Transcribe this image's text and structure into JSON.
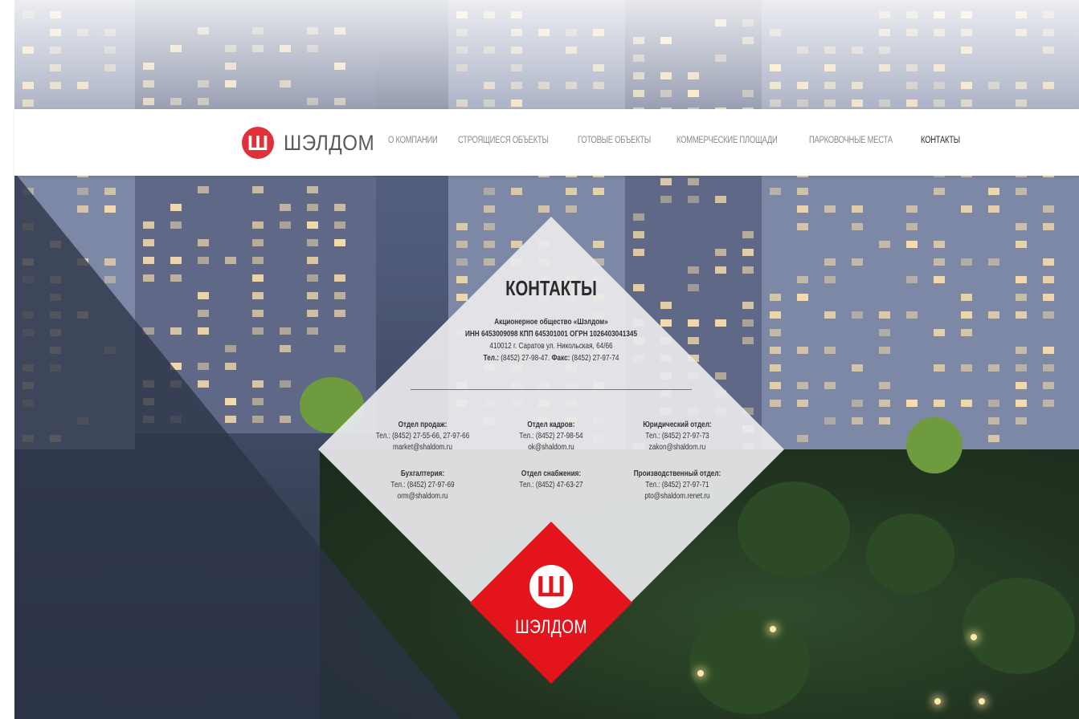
{
  "brand": {
    "name": "ШЭЛДОМ",
    "logo_glyph": "Ш",
    "accent_color": "#e3141c"
  },
  "nav": {
    "items": [
      {
        "label": "О КОМПАНИИ",
        "active": false
      },
      {
        "label": "СТРОЯЩИЕСЯ ОБЪЕКТЫ",
        "active": false
      },
      {
        "label": "ГОТОВЫЕ ОБЪЕКТЫ",
        "active": false
      },
      {
        "label": "КОММЕРЧЕСКИЕ ПЛОЩАДИ",
        "active": false
      },
      {
        "label": "ПАРКОВОЧНЫЕ МЕСТА",
        "active": false
      },
      {
        "label": "КОНТАКТЫ",
        "active": true
      }
    ]
  },
  "contacts": {
    "title": "КОНТАКТЫ",
    "company": "Акционерное общество «Шэлдом»",
    "registration": "ИНН 6453009098 КПП 645301001 ОГРН 1026403041345",
    "address": "410012 г. Саратов ул. Никольская, 64/66",
    "phone_label": "Тел.:",
    "phone": "(8452) 27-98-47.",
    "fax_label": "Факс:",
    "fax": "(8452) 27-97-74"
  },
  "departments": [
    {
      "name": "Отдел продаж:",
      "lines": [
        "Тел.: (8452) 27-55-66, 27-97-66",
        "market@shaldom.ru"
      ]
    },
    {
      "name": "Отдел кадров:",
      "lines": [
        "Тел.: (8452) 27-98-54",
        "ok@shaldom.ru"
      ]
    },
    {
      "name": "Юридический отдел:",
      "lines": [
        "Тел.: (8452) 27-97-73",
        "zakon@shaldom.ru"
      ]
    },
    {
      "name": "Бухгалтерия:",
      "lines": [
        "Тел.: (8452) 27-97-69",
        "orm@shaldom.ru"
      ]
    },
    {
      "name": "Отдел снабжения:",
      "lines": [
        "Тел.: (8452) 47-63-27"
      ]
    },
    {
      "name": "Производственный отдел:",
      "lines": [
        "Тел.: (8452) 27-97-71",
        "pto@shaldom.renet.ru"
      ]
    }
  ]
}
